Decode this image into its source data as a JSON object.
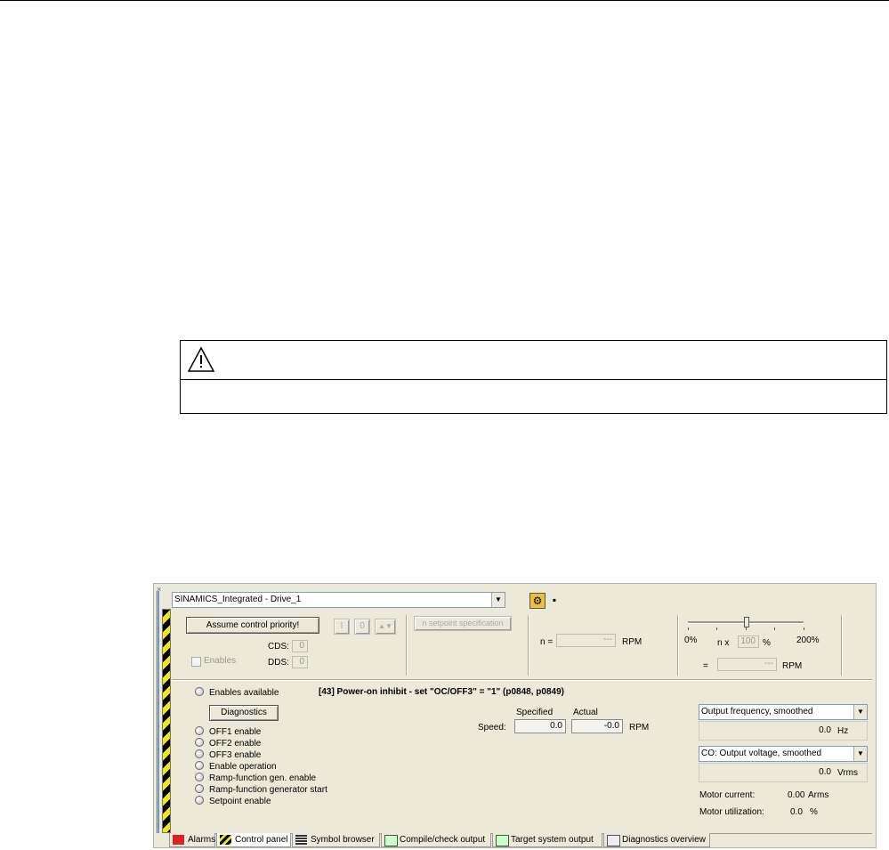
{
  "app": {
    "drive_select": "SINAMICS_Integrated - Drive_1",
    "assume_control_button": "Assume control priority!",
    "cds_label": "CDS:",
    "cds_value": "0",
    "dds_label": "DDS:",
    "dds_value": "0",
    "enables_label": "Enables",
    "on_button": "I",
    "off_button": "0",
    "jog_button": "▲▼",
    "setpoint_spec_button": "n setpoint specification",
    "n_label": "n =",
    "n_value": "---",
    "rpm_unit": "RPM",
    "slider_min": "0%",
    "slider_max": "200%",
    "n_x_label": "n x",
    "n_x_value": "100",
    "percent_unit": "%",
    "eq_label": "=",
    "eq_value": "---",
    "eq_unit": "RPM",
    "enables_available": "Enables available",
    "status_message": "[43] Power-on inhibit - set \"OC/OFF3\" = \"1\" (p0848, p0849)",
    "diagnostics_button": "Diagnostics",
    "enable_list": [
      "OFF1 enable",
      "OFF2 enable",
      "OFF3 enable",
      "Enable operation",
      "Ramp-function gen. enable",
      "Ramp-function generator start",
      "Setpoint enable"
    ],
    "specified_label": "Specified",
    "actual_label": "Actual",
    "speed_label": "Speed:",
    "speed_specified": "0.0",
    "speed_actual": "-0.0",
    "speed_unit": "RPM",
    "output_freq_select": "Output frequency, smoothed",
    "output_freq_value": "0.0",
    "output_freq_unit": "Hz",
    "output_volt_select": "CO: Output voltage, smoothed",
    "output_volt_value": "0.0",
    "output_volt_unit": "Vrms",
    "motor_current_label": "Motor current:",
    "motor_current_value": "0.00",
    "motor_current_unit": "Arms",
    "motor_util_label": "Motor utilization:",
    "motor_util_value": "0.0",
    "motor_util_unit": "%",
    "tabs": [
      "Alarms",
      "Control panel",
      "Symbol browser",
      "Compile/check output",
      "Target system output",
      "Diagnostics overview"
    ]
  },
  "colors": {
    "window_bg": "#ece9d8",
    "hazard_yellow": "#f2e51a",
    "hazard_black": "#000000",
    "link_blue": "#2c56c9"
  },
  "icons": {
    "warning": "warning-triangle-icon",
    "dropdown": "chevron-down-icon",
    "alarm_tab": "alarm-icon",
    "control_tab": "hazard-icon"
  }
}
